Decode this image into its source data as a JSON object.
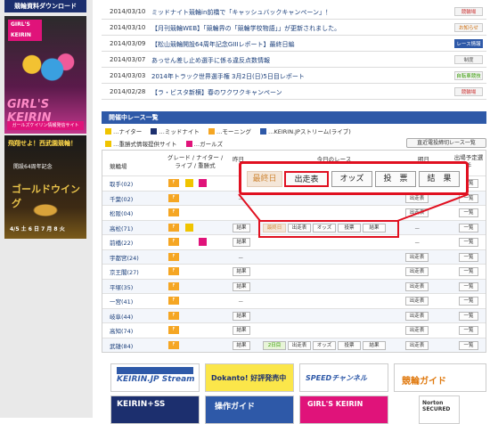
{
  "sidebar": {
    "top_link": "競輪資料ダウンロード",
    "ad1": {
      "logo": "GIRL'S KEIRIN",
      "big": "GIRL'S KEIRIN",
      "sub": "ガールズケイリン情報発信サイト"
    },
    "ad2": {
      "t1": "飛翔せよ！西武園競輪！",
      "t2": "開設64周年記念",
      "t3": "ゴールドウイング",
      "t4": "4/5 土 6 日 7 月 8 火"
    }
  },
  "news": [
    {
      "date": "2014/03/10",
      "title": "ミッドナイト競輪in前橋で「キャッシュバックキャンペーン」！",
      "badge": "競輪場"
    },
    {
      "date": "2014/03/10",
      "title": "【月刊競輪WEB】「競輪界の「競輪学校物語」」が更新されました。",
      "badge": "お知らせ"
    },
    {
      "date": "2014/03/09",
      "title": "【松山競輪開設64周年記念GIIIレポート】最終日編",
      "badge": "レース情報"
    },
    {
      "date": "2014/03/07",
      "title": "あっせん差し止め選手に係る違反点数情報",
      "badge": "制度"
    },
    {
      "date": "2014/03/03",
      "title": "2014年トラック世界選手権 3月2日(日)5日目レポート",
      "badge": "自転車競技"
    },
    {
      "date": "2014/02/28",
      "title": "【ラ・ビスタ新横】春のワクワクキャンペーン",
      "badge": "競輪場"
    }
  ],
  "section": {
    "title": "開催中レース一覧",
    "legend1": [
      "…ナイター",
      "…ミッドナイト",
      "…モーニング",
      "…KEIRIN.JPストリーム(ライブ)"
    ],
    "legend2": [
      "…重勝式情報提供サイト",
      "…ガールズ"
    ],
    "switch_btn": "直近電投締切レース一覧"
  },
  "table": {
    "headers": {
      "venue": "競輪場",
      "grade": "グレード / ナイター / ライブ / 重勝式",
      "yesterday": "昨日",
      "today": "今日のレース",
      "tomorrow": "明日",
      "next": "出場予定選手"
    },
    "rows": [
      {
        "venue": "取手(02)",
        "y": "",
        "today": "",
        "t": "出走表",
        "n": "一覧"
      },
      {
        "venue": "千葉(02)",
        "y": "－",
        "today": "",
        "t": "出走表",
        "n": "一覧"
      },
      {
        "venue": "松阪(04)",
        "y": "",
        "today": "",
        "t": "出走表",
        "n": "一覧"
      },
      {
        "venue": "高松(71)",
        "y": "結果",
        "today": "final",
        "t": "－",
        "n": "一覧"
      },
      {
        "venue": "前橋(22)",
        "y": "結果",
        "today": "",
        "t": "－",
        "n": "一覧"
      },
      {
        "venue": "宇都宮(24)",
        "y": "－",
        "today": "",
        "t": "出走表",
        "n": "一覧"
      },
      {
        "venue": "京王閣(27)",
        "y": "結果",
        "today": "",
        "t": "出走表",
        "n": "一覧"
      },
      {
        "venue": "平塚(35)",
        "y": "結果",
        "today": "",
        "t": "出走表",
        "n": "一覧"
      },
      {
        "venue": "一宮(41)",
        "y": "－",
        "today": "",
        "t": "出走表",
        "n": "一覧"
      },
      {
        "venue": "岐阜(44)",
        "y": "結果",
        "today": "",
        "t": "出走表",
        "n": "一覧"
      },
      {
        "venue": "高知(74)",
        "y": "結果",
        "today": "",
        "t": "出走表",
        "n": "一覧"
      },
      {
        "venue": "武雄(84)",
        "y": "結果",
        "today": "2日目",
        "t": "出走表",
        "n": "一覧"
      }
    ],
    "today_buttons": [
      "出走表",
      "オッズ",
      "投票",
      "結果"
    ],
    "final_label": "最終日"
  },
  "callout": {
    "final": "最終日",
    "b1": "出走表",
    "b2": "オッズ",
    "b3": "投　票",
    "b4": "結　果"
  },
  "banners": [
    {
      "text": "KEIRIN.JP Stream"
    },
    {
      "text": "Dokanto! 好評発売中"
    },
    {
      "text": "SPEEDチャンネル"
    },
    {
      "text": "競輪ガイド"
    },
    {
      "text": "KEIRIN+SS"
    },
    {
      "text": "操作ガイド"
    },
    {
      "text": "GIRL'S KEIRIN"
    },
    {
      "text": "Norton SECURED"
    }
  ]
}
